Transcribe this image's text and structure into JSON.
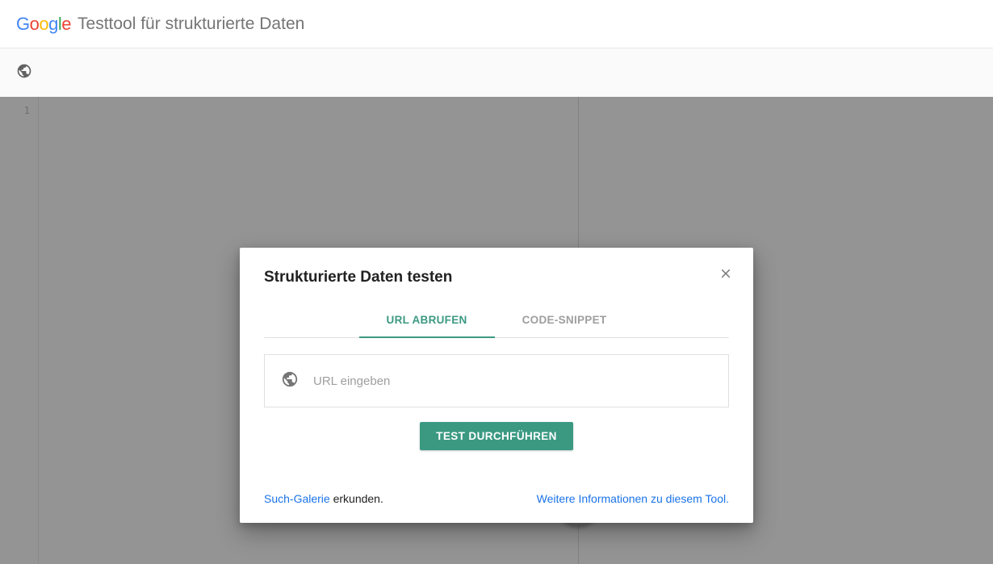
{
  "header": {
    "logo_letters": [
      "G",
      "o",
      "o",
      "g",
      "l",
      "e"
    ],
    "title": "Testtool für strukturierte Daten"
  },
  "editor": {
    "line_number": "1"
  },
  "modal": {
    "title": "Strukturierte Daten testen",
    "tabs": {
      "url": "URL ABRUFEN",
      "snippet": "CODE-SNIPPET"
    },
    "input_placeholder": "URL eingeben",
    "run_button": "TEST DURCHFÜHREN",
    "footer": {
      "gallery_link": "Such-Galerie",
      "gallery_suffix": " erkunden.",
      "more_info": "Weitere Informationen zu diesem Tool."
    }
  }
}
